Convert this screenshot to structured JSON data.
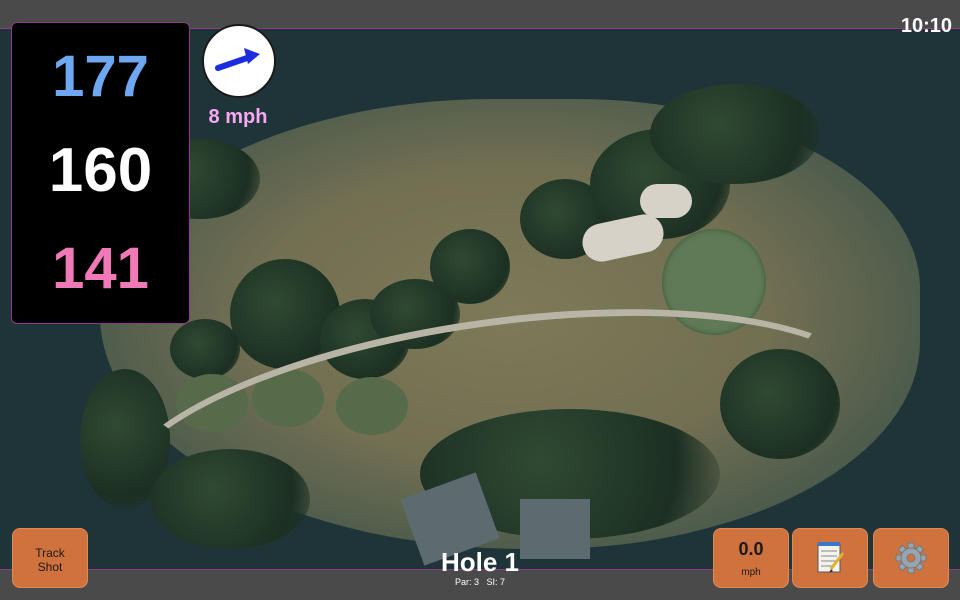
{
  "status": {
    "time": "10:10"
  },
  "distances": {
    "back": "177",
    "center": "160",
    "front": "141"
  },
  "wind": {
    "speed": "8 mph",
    "icon": "arrow-right-icon",
    "arrow_color": "#1a2ee0"
  },
  "hole": {
    "title": "Hole 1",
    "par": "Par: 3",
    "si": "SI: 7"
  },
  "buttons": {
    "track_shot": [
      "Track",
      "Shot"
    ],
    "wind_value": "0.0",
    "wind_unit": "mph",
    "notes_icon": "notepad-icon",
    "settings_icon": "gear-icon"
  },
  "colors": {
    "back": "#6fa8f2",
    "center": "#ffffff",
    "front": "#f07ab8",
    "accent": "#8a3c8a",
    "button": "#d0723e"
  }
}
